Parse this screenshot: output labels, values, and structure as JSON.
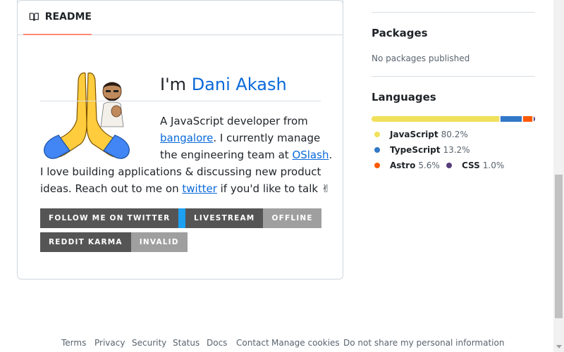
{
  "readme": {
    "tab_label": "README",
    "heading_prefix": "I'm ",
    "heading_name": "Dani Akash",
    "lines": {
      "l1": "A JavaScript developer from",
      "l2_link": "bangalore",
      "l2_rest": ". I currently manage",
      "l3_pre": "the engineering team at ",
      "l3_link": "OSlash",
      "l3_post": ".",
      "l4": "I love building applications & discussing new product",
      "l5_pre": "ideas. Reach out to me on ",
      "l5_link": "twitter",
      "l5_post": " if you'd like to talk ✌"
    },
    "badges": {
      "twitter": {
        "label": "FOLLOW ME ON TWITTER"
      },
      "livestream": {
        "label": "LIVESTREAM",
        "value": "OFFLINE"
      },
      "reddit": {
        "label": "REDDIT KARMA",
        "value": "INVALID"
      }
    }
  },
  "sidebar": {
    "packages": {
      "title": "Packages",
      "empty": "No packages published"
    },
    "languages": {
      "title": "Languages",
      "items": [
        {
          "name": "JavaScript",
          "percent": "80.2%",
          "value": 80.2,
          "color": "#f1e05a"
        },
        {
          "name": "TypeScript",
          "percent": "13.2%",
          "value": 13.2,
          "color": "#3178c6"
        },
        {
          "name": "Astro",
          "percent": "5.6%",
          "value": 5.6,
          "color": "#ff5a03"
        },
        {
          "name": "CSS",
          "percent": "1.0%",
          "value": 1.0,
          "color": "#563d7c"
        }
      ]
    }
  },
  "footer": {
    "links": [
      "Terms",
      "Privacy",
      "Security",
      "Status",
      "Docs",
      "Contact",
      "Manage cookies",
      "Do not share my personal information"
    ]
  }
}
